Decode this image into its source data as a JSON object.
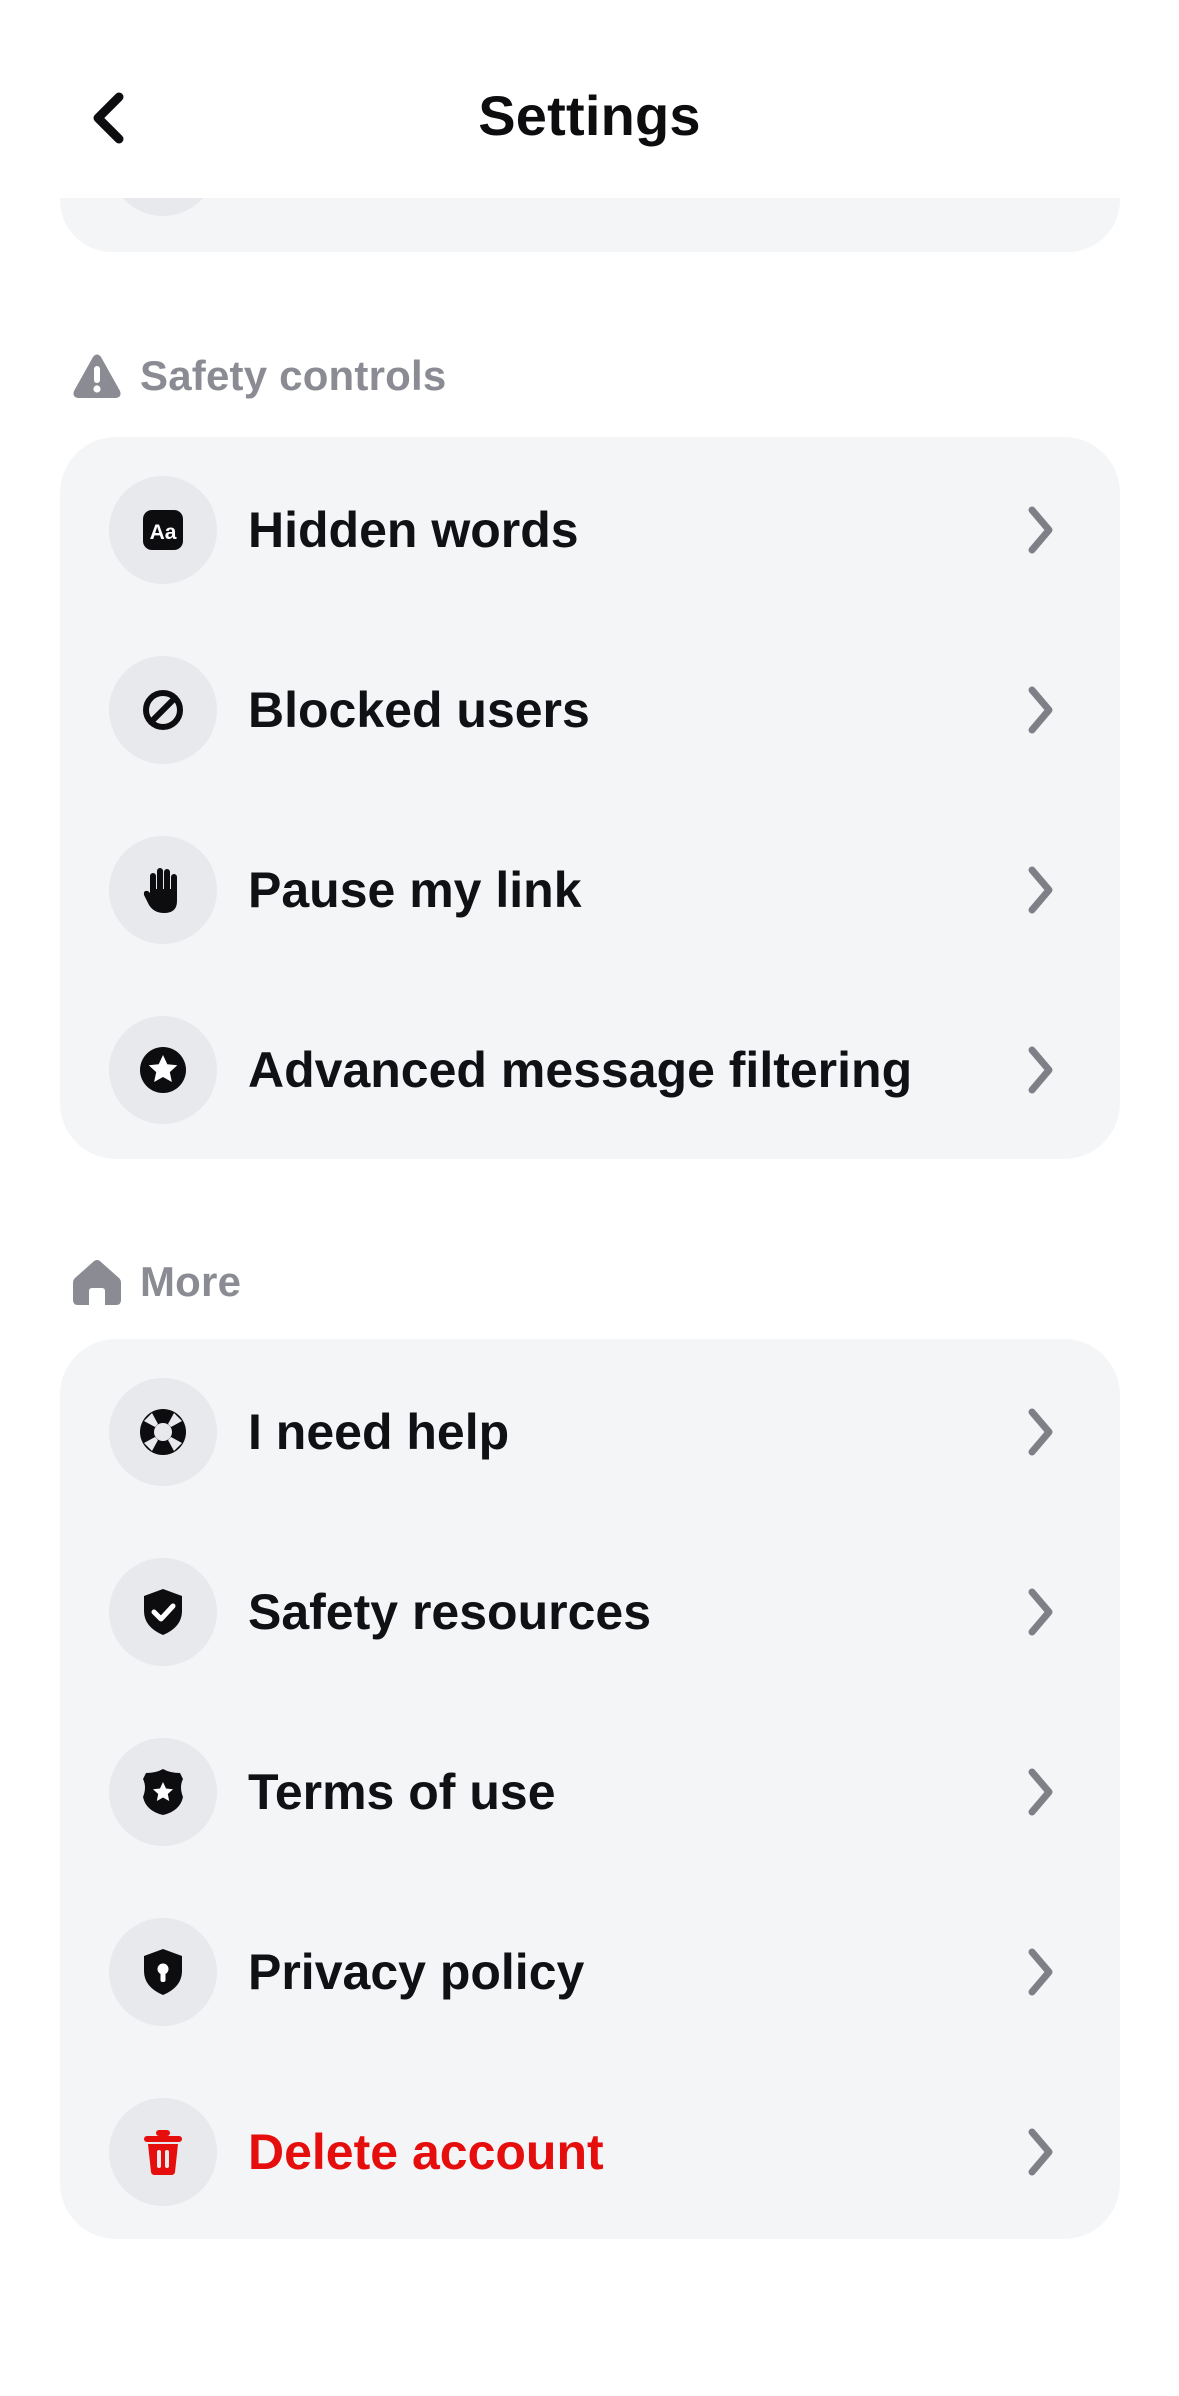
{
  "header": {
    "title": "Settings",
    "back_icon": "chevron-left-icon"
  },
  "sections": [
    {
      "label": "Safety controls",
      "icon": "warning-icon",
      "items": [
        {
          "label": "Hidden words",
          "icon": "text-aa-icon"
        },
        {
          "label": "Blocked users",
          "icon": "block-icon"
        },
        {
          "label": "Pause my link",
          "icon": "hand-stop-icon"
        },
        {
          "label": "Advanced message filtering",
          "icon": "star-badge-icon"
        }
      ]
    },
    {
      "label": "More",
      "icon": "home-icon",
      "items": [
        {
          "label": "I need help",
          "icon": "lifebuoy-icon"
        },
        {
          "label": "Safety resources",
          "icon": "shield-check-icon"
        },
        {
          "label": "Terms of use",
          "icon": "police-badge-icon"
        },
        {
          "label": "Privacy policy",
          "icon": "shield-lock-icon"
        },
        {
          "label": "Delete account",
          "icon": "trash-icon",
          "danger": true
        }
      ]
    }
  ],
  "colors": {
    "background": "#ffffff",
    "card": "#f4f5f7",
    "icon_circle": "#e8e9ec",
    "section_label": "#8a8b93",
    "chevron": "#7e7f87",
    "danger": "#e60d0d",
    "text": "#101114"
  }
}
